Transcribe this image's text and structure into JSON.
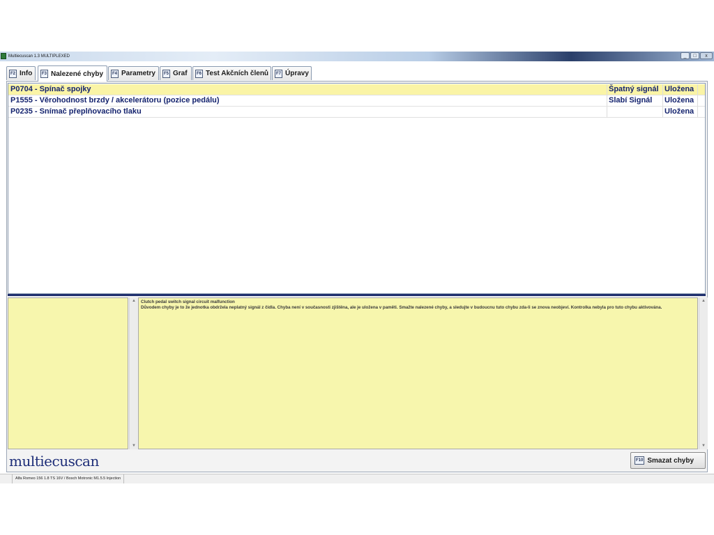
{
  "window": {
    "title": "Multiecuscan 1.3 MULTIPLEXED",
    "controls": [
      "_",
      "□",
      "x"
    ]
  },
  "tabs": [
    {
      "key": "F2",
      "label": "Info",
      "active": false
    },
    {
      "key": "F3",
      "label": "Nalezené chyby",
      "active": true
    },
    {
      "key": "F4",
      "label": "Parametry",
      "active": false
    },
    {
      "key": "F5",
      "label": "Graf",
      "active": false
    },
    {
      "key": "F6",
      "label": "Test Akčních členů",
      "active": false
    },
    {
      "key": "F7",
      "label": "Úpravy",
      "active": false
    }
  ],
  "faults": [
    {
      "description": "P0704 - Spínač spojky",
      "signal": "Špatný signál",
      "status": "Uložena",
      "selected": true
    },
    {
      "description": "P1555 - Věrohodnost brzdy / akcelerátoru (pozice pedálu)",
      "signal": "Slabí Signál",
      "status": "Uložena",
      "selected": false
    },
    {
      "description": "P0235 - Snímač přeplňovacího tlaku",
      "signal": "",
      "status": "Uložena",
      "selected": false
    }
  ],
  "details": {
    "title": "Clutch pedal switch signal circuit malfunction",
    "text": "Důvodem chyby je to že jednotka obdržela neplatný signál z čidla. Chyba není v současnosti zjištěna, ale je uložena v paměti. Smažte nalezené chyby, a sledujte v budoucnu tuto chybu zda-li se znova neobjeví. Kontrolka nebyla pro tuto chybu aktivována."
  },
  "footer": {
    "logo": "multiecuscan",
    "clear_key": "F10",
    "clear_label": "Smazat chyby"
  },
  "statusbar": {
    "vehicle": "Alfa Romeo 156 1.8 TS 16V / Bosch Motronic M1.5.5 Injection"
  },
  "colors": {
    "selected_row": "#faf4a6",
    "detail_background": "#f7f6ad",
    "fault_text": "#14236e",
    "logo": "#1d2d78"
  }
}
